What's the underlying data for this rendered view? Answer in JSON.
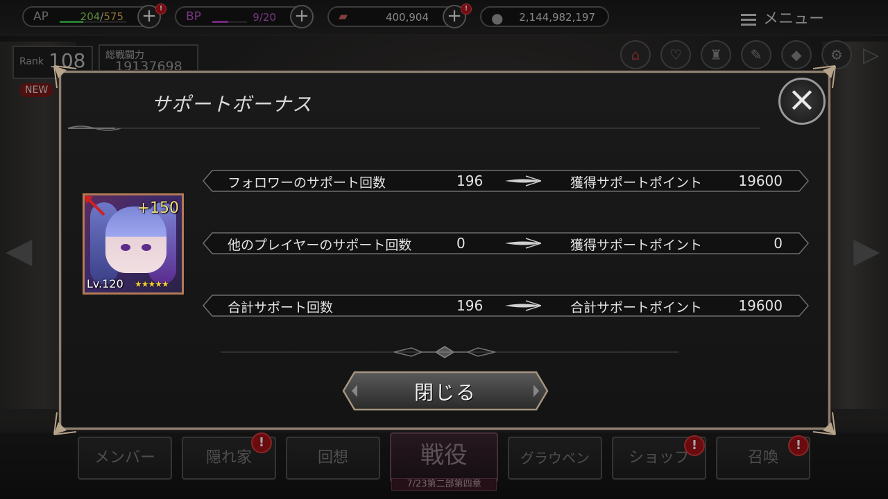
{
  "topbar": {
    "ap": {
      "label": "AP",
      "current": "204",
      "max": "575",
      "fill": 0.35
    },
    "bp": {
      "label": "BP",
      "current": "9",
      "max": "20",
      "fill": 0.45
    },
    "gems": "400,904",
    "coins": "2,144,982,197",
    "menu_label": "メニュー",
    "alert": "!"
  },
  "profile": {
    "rank_label": "Rank",
    "rank": "108",
    "power_label": "総戦闘力",
    "power": "19137698",
    "news": "NEW"
  },
  "modal": {
    "title": "サポートボーナス",
    "close_label": "閉じる",
    "card": {
      "bonus": "+150",
      "level": "Lv.120",
      "stars": "★★★★★"
    },
    "rows": [
      {
        "label": "フォロワーのサポート回数",
        "count": "196",
        "result_label": "獲得サポートポイント",
        "points": "19600"
      },
      {
        "label": "他のプレイヤーのサポート回数",
        "count": "0",
        "result_label": "獲得サポートポイント",
        "points": "0"
      },
      {
        "label": "合計サポート回数",
        "count": "196",
        "result_label": "合計サポートポイント",
        "points": "19600"
      }
    ]
  },
  "nav": {
    "member": "メンバー",
    "hideout": "隠れ家",
    "recall": "回想",
    "battle": "戦役",
    "battle_sub": "7/23第二部第四章",
    "grauben": "グラウベン",
    "shop": "ショップ",
    "summon": "召喚",
    "alert": "!"
  },
  "colors": {
    "frame": "#8d7f70",
    "ap_bar": "#39c24a",
    "bp_bar": "#b43cc2",
    "bonus": "#f2dd7a"
  }
}
